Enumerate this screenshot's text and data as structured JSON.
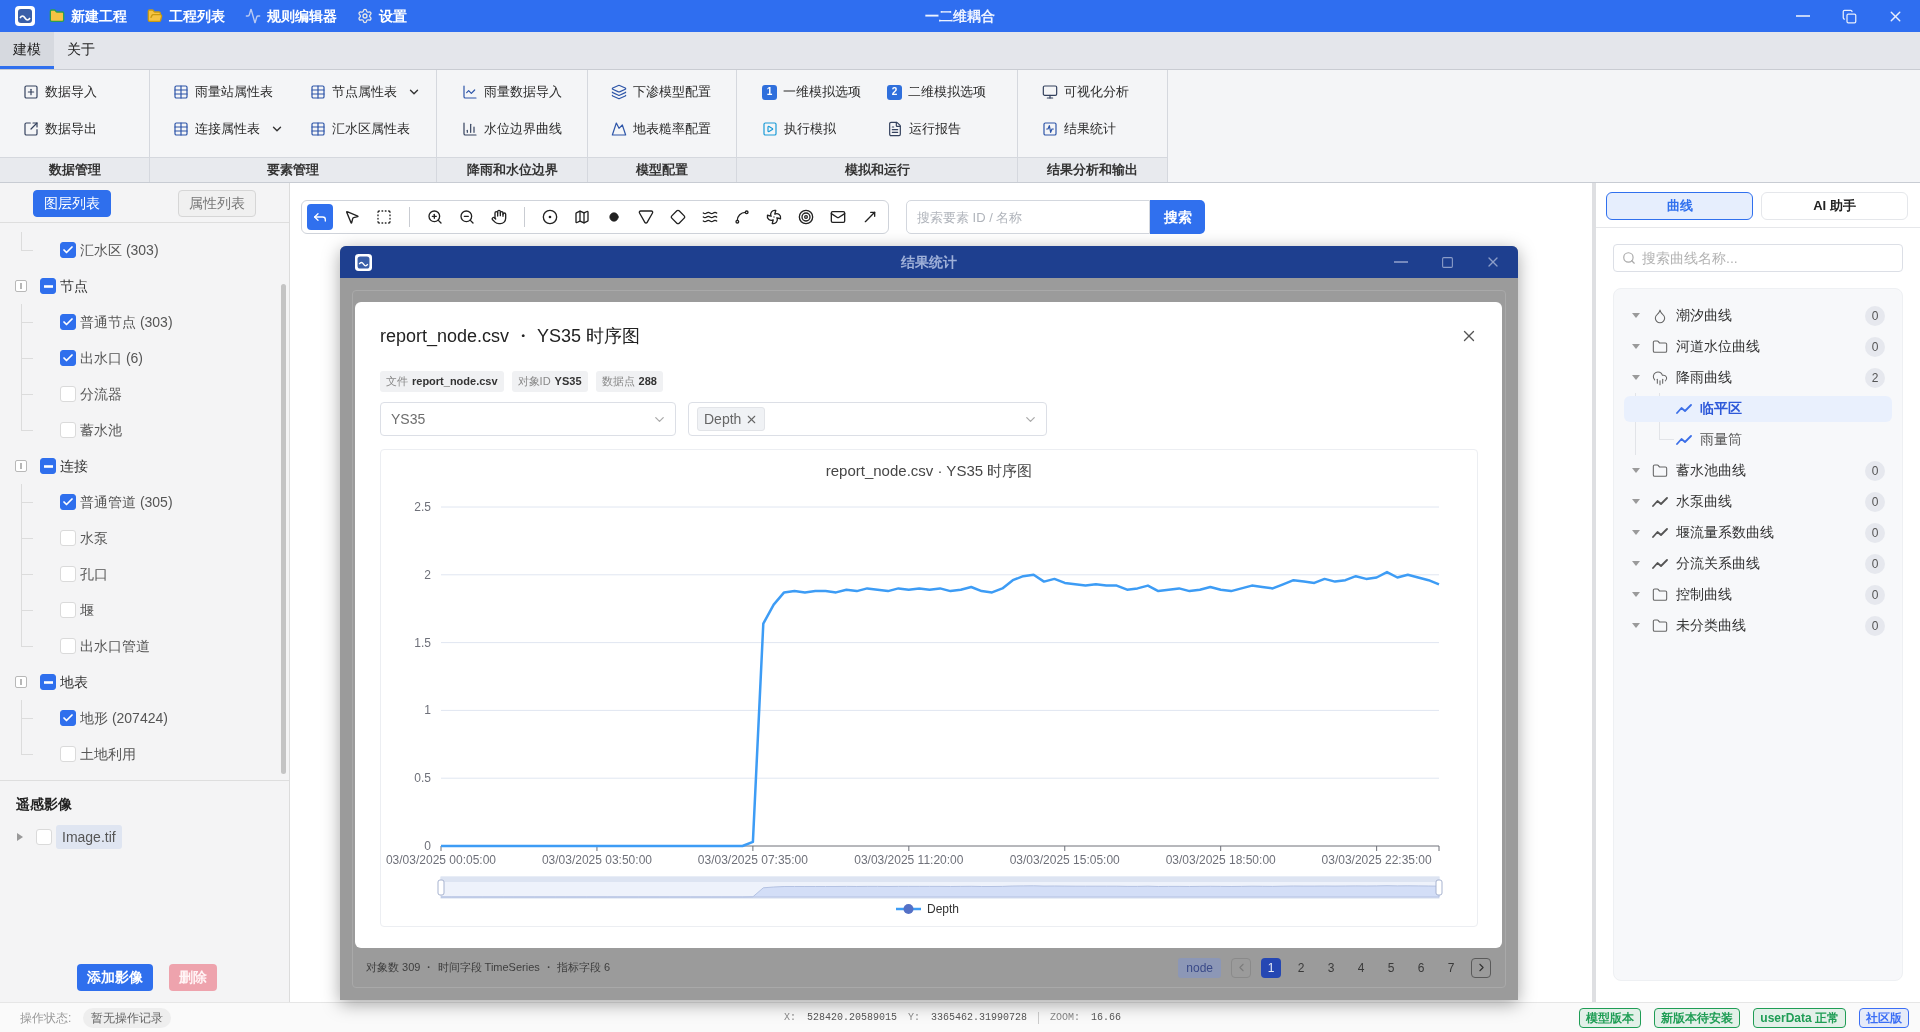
{
  "title_bar": {
    "menu": [
      "新建工程",
      "工程列表",
      "规则编辑器",
      "设置"
    ],
    "title": "一二维耦合"
  },
  "menu_tabs": [
    {
      "label": "建模",
      "selected": true
    },
    {
      "label": "关于",
      "selected": false
    }
  ],
  "ribbon": [
    {
      "title": "数据管理",
      "rows": [
        [
          {
            "label": "数据导入",
            "has_menu": false
          }
        ],
        [
          {
            "label": "数据导出",
            "has_menu": false
          }
        ]
      ]
    },
    {
      "title": "要素管理",
      "rows": [
        [
          {
            "label": "雨量站属性表",
            "has_menu": false
          },
          {
            "label": "节点属性表",
            "has_menu": true
          }
        ],
        [
          {
            "label": "连接属性表",
            "has_menu": true
          },
          {
            "label": "汇水区属性表",
            "has_menu": false
          }
        ]
      ]
    },
    {
      "title": "降雨和水位边界",
      "rows": [
        [
          {
            "label": "雨量数据导入",
            "has_menu": false
          }
        ],
        [
          {
            "label": "水位边界曲线",
            "has_menu": false
          }
        ]
      ]
    },
    {
      "title": "模型配置",
      "rows": [
        [
          {
            "label": "下渗模型配置",
            "has_menu": false
          }
        ],
        [
          {
            "label": "地表糙率配置",
            "has_menu": false
          }
        ]
      ]
    },
    {
      "title": "模拟和运行",
      "rows": [
        [
          {
            "label": "一维模拟选项",
            "icon_text": "1",
            "has_menu": false
          },
          {
            "label": "二维模拟选项",
            "icon_text": "2",
            "has_menu": false
          }
        ],
        [
          {
            "label": "执行模拟",
            "has_menu": false
          },
          {
            "label": "运行报告",
            "has_menu": false
          }
        ]
      ]
    },
    {
      "title": "结果分析和输出",
      "rows": [
        [
          {
            "label": "可视化分析",
            "has_menu": false
          }
        ],
        [
          {
            "label": "结果统计",
            "has_menu": false
          }
        ]
      ]
    }
  ],
  "left_tabs": [
    {
      "label": "图层列表",
      "selected": true
    },
    {
      "label": "属性列表",
      "selected": false
    }
  ],
  "layer_tree": [
    {
      "children": [
        {
          "label": "汇水区 (303)",
          "checked": true
        }
      ]
    },
    {
      "label": "节点",
      "indeterminate": true,
      "children": [
        {
          "label": "普通节点 (303)",
          "checked": true
        },
        {
          "label": "出水口 (6)",
          "checked": true
        },
        {
          "label": "分流器",
          "checked": false
        },
        {
          "label": "蓄水池",
          "checked": false
        }
      ]
    },
    {
      "label": "连接",
      "indeterminate": true,
      "children": [
        {
          "label": "普通管道 (305)",
          "checked": true
        },
        {
          "label": "水泵",
          "checked": false
        },
        {
          "label": "孔口",
          "checked": false
        },
        {
          "label": "堰",
          "checked": false
        },
        {
          "label": "出水口管道",
          "checked": false
        }
      ]
    },
    {
      "label": "地表",
      "indeterminate": true,
      "children": [
        {
          "label": "地形 (207424)",
          "checked": true
        },
        {
          "label": "土地利用",
          "checked": false
        }
      ]
    }
  ],
  "remote_sensing": {
    "title": "遥感影像",
    "items": [
      {
        "label": "Image.tif",
        "checked": false
      }
    ]
  },
  "left_buttons": [
    {
      "label": "添加影像",
      "kind": "primary",
      "disabled": false
    },
    {
      "label": "删除",
      "kind": "danger",
      "disabled": true
    }
  ],
  "toolbar": {
    "groups": [
      [
        {
          "selected": true
        },
        {
          "selected": false
        },
        {
          "selected": false
        }
      ],
      [
        {
          "selected": false
        },
        {
          "selected": false
        },
        {
          "selected": false
        }
      ],
      [
        {
          "selected": false
        },
        {
          "selected": false
        },
        {
          "selected": false
        },
        {
          "selected": false
        },
        {
          "selected": false
        },
        {
          "selected": false
        },
        {
          "selected": false
        },
        {
          "selected": false
        },
        {
          "selected": false
        },
        {
          "selected": false
        },
        {
          "selected": false
        }
      ]
    ]
  },
  "element_search": {
    "placeholder": "搜索要素 ID / 名称",
    "button": "搜索"
  },
  "result_window": {
    "title": "结果统计",
    "modal": {
      "title": "report_node.csv ・ YS35 时序图",
      "meta": [
        {
          "label": "文件",
          "value": "report_node.csv"
        },
        {
          "label": "对象ID",
          "value": "YS35"
        },
        {
          "label": "数据点",
          "value": "288"
        }
      ],
      "object_select": {
        "value": "YS35"
      },
      "metric_select": {
        "tags": [
          "Depth"
        ]
      },
      "chart_data": {
        "type": "line",
        "title": "report_node.csv · YS35 时序图",
        "grid": true,
        "ylim": [
          0,
          2.5
        ],
        "yticks": [
          0,
          0.5,
          1,
          1.5,
          2,
          2.5
        ],
        "categories": [
          "03/03/2025 00:05:00",
          null,
          null,
          null,
          null,
          null,
          null,
          null,
          null,
          null,
          null,
          null,
          null,
          null,
          null,
          "03/03/2025 03:50:00",
          null,
          null,
          null,
          null,
          null,
          null,
          null,
          null,
          null,
          null,
          null,
          null,
          null,
          null,
          "03/03/2025 07:35:00",
          null,
          null,
          null,
          null,
          null,
          null,
          null,
          null,
          null,
          null,
          null,
          null,
          null,
          null,
          "03/03/2025 11:20:00",
          null,
          null,
          null,
          null,
          null,
          null,
          null,
          null,
          null,
          null,
          null,
          null,
          null,
          null,
          "03/03/2025 15:05:00",
          null,
          null,
          null,
          null,
          null,
          null,
          null,
          null,
          null,
          null,
          null,
          null,
          null,
          null,
          "03/03/2025 18:50:00",
          null,
          null,
          null,
          null,
          null,
          null,
          null,
          null,
          null,
          null,
          null,
          null,
          null,
          null,
          "03/03/2025 22:35:00",
          null,
          null,
          null,
          null,
          null,
          null
        ],
        "series": [
          {
            "name": "Depth",
            "color": "#3d9cf5",
            "values": [
              0,
              0,
              0,
              0,
              0,
              0,
              0,
              0,
              0,
              0,
              0,
              0,
              0,
              0,
              0,
              0,
              0,
              0,
              0,
              0,
              0,
              0,
              0,
              0,
              0,
              0,
              0,
              0,
              0,
              0,
              0.03,
              1.64,
              1.78,
              1.87,
              1.88,
              1.87,
              1.88,
              1.88,
              1.87,
              1.89,
              1.88,
              1.9,
              1.89,
              1.88,
              1.9,
              1.89,
              1.9,
              1.89,
              1.9,
              1.88,
              1.89,
              1.91,
              1.88,
              1.87,
              1.9,
              1.96,
              1.99,
              2.0,
              1.95,
              1.97,
              1.94,
              1.93,
              1.92,
              1.93,
              1.92,
              1.92,
              1.89,
              1.9,
              1.92,
              1.88,
              1.89,
              1.9,
              1.88,
              1.89,
              1.91,
              1.89,
              1.88,
              1.9,
              1.92,
              1.91,
              1.9,
              1.93,
              1.96,
              1.95,
              1.94,
              1.97,
              1.95,
              1.96,
              1.99,
              1.97,
              1.98,
              2.02,
              1.98,
              2.0,
              1.98,
              1.96,
              1.93
            ]
          }
        ]
      }
    },
    "footer": {
      "summary": "对象数 309 ・ 时间字段 TimeSeries ・ 指标字段 6",
      "type_tag": "node",
      "prev_disabled": true,
      "next_disabled": false,
      "pages": [
        {
          "label": "1",
          "selected": true
        },
        {
          "label": "2",
          "selected": false
        },
        {
          "label": "3",
          "selected": false
        },
        {
          "label": "4",
          "selected": false
        },
        {
          "label": "5",
          "selected": false
        },
        {
          "label": "6",
          "selected": false
        },
        {
          "label": "7",
          "selected": false
        }
      ]
    }
  },
  "curve_tabs": [
    {
      "label": "曲线",
      "selected": true
    },
    {
      "label": "AI 助手",
      "selected": false
    }
  ],
  "curve_search": {
    "placeholder": "搜索曲线名称..."
  },
  "curve_tree": [
    {
      "kind": "drop",
      "label": "潮汐曲线",
      "count": "0"
    },
    {
      "kind": "folder",
      "label": "河道水位曲线",
      "count": "0"
    },
    {
      "kind": "rain",
      "label": "降雨曲线",
      "count": "2",
      "children": [
        {
          "label": "临平区",
          "selected": true
        },
        {
          "label": "雨量筒",
          "selected": false
        }
      ]
    },
    {
      "kind": "folder",
      "label": "蓄水池曲线",
      "count": "0"
    },
    {
      "kind": "trend",
      "label": "水泵曲线",
      "count": "0"
    },
    {
      "kind": "trend",
      "label": "堰流量系数曲线",
      "count": "0"
    },
    {
      "kind": "trend",
      "label": "分流关系曲线",
      "count": "0"
    },
    {
      "kind": "folder",
      "label": "控制曲线",
      "count": "0"
    },
    {
      "kind": "folder",
      "label": "未分类曲线",
      "count": "0"
    }
  ],
  "status_bar": {
    "label": "操作状态:",
    "value": "暂无操作记录",
    "position": [
      {
        "label": "X:",
        "value": "528420.20589015"
      },
      {
        "label": "Y:",
        "value": "3365462.31990728"
      }
    ],
    "zoom": {
      "label": "ZOOM:",
      "value": "16.66"
    },
    "badges": [
      {
        "label": "模型版本",
        "color": "#1f9d55"
      },
      {
        "label": "新版本待安装",
        "color": "#1f9d55"
      },
      {
        "label": "userData 正常",
        "color": "#1f9d55"
      },
      {
        "label": "社区版",
        "color": "#3b6ef5"
      }
    ]
  }
}
